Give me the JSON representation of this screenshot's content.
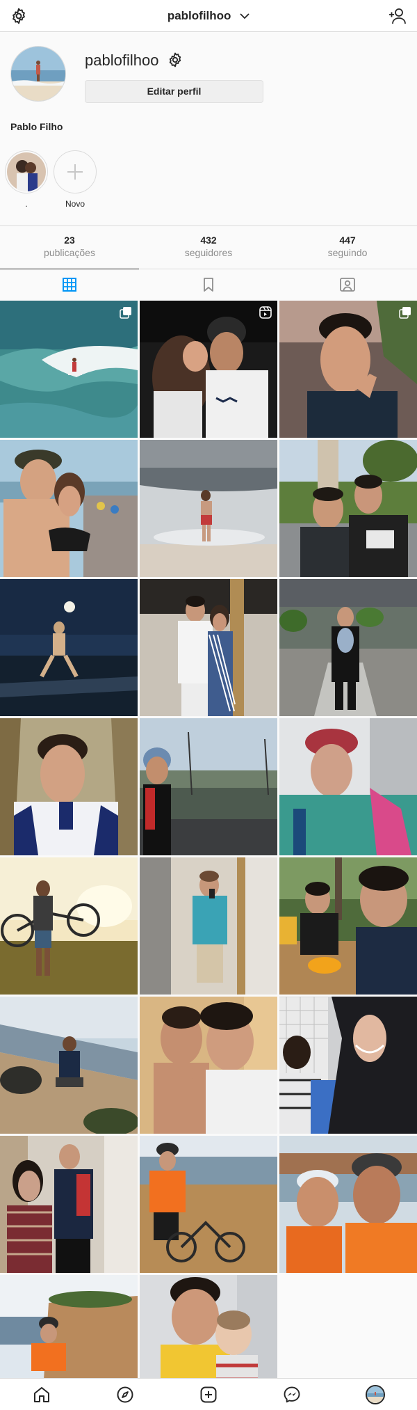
{
  "header": {
    "username": "pablofilhoo"
  },
  "profile": {
    "username": "pablofilhoo",
    "edit_label": "Editar perfil",
    "full_name": "Pablo Filho"
  },
  "highlights": [
    {
      "label": "."
    },
    {
      "label": "Novo"
    }
  ],
  "stats": [
    {
      "value": "23",
      "label": "publicações"
    },
    {
      "value": "432",
      "label": "seguidores"
    },
    {
      "value": "447",
      "label": "seguindo"
    }
  ],
  "tabs": [
    "grid-icon",
    "saved-icon",
    "tagged-icon"
  ],
  "posts": [
    {
      "badge": "carousel"
    },
    {
      "badge": "reels"
    },
    {
      "badge": "carousel"
    },
    {},
    {},
    {},
    {},
    {},
    {},
    {},
    {},
    {},
    {},
    {},
    {},
    {},
    {},
    {},
    {},
    {},
    {},
    {},
    {}
  ],
  "nav": [
    "home-icon",
    "explore-icon",
    "new-post-icon",
    "messenger-icon",
    "profile-avatar"
  ],
  "colors": {
    "border": "#dbdbdb",
    "muted": "#8e8e8e",
    "text": "#262626",
    "accent": "#0095f6"
  }
}
